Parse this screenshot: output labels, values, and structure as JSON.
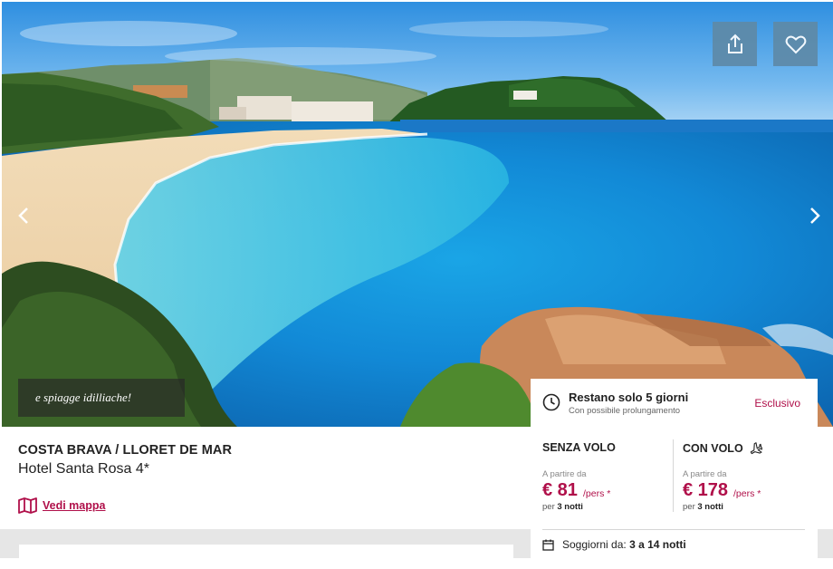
{
  "hero": {
    "caption": "e spiagge idilliache!",
    "share_icon": "share-icon",
    "favorite_icon": "heart-icon",
    "prev_icon": "chevron-left-icon",
    "next_icon": "chevron-right-icon"
  },
  "listing": {
    "destination": "COSTA BRAVA / LLORET DE MAR",
    "hotel_name": "Hotel Santa Rosa 4*",
    "map_link": "Vedi mappa",
    "map_icon": "map-icon"
  },
  "offer": {
    "availability": "Restano solo 5 giorni",
    "extension_note": "Con possibile prolungamento",
    "exclusive_badge": "Esclusivo",
    "without_flight": {
      "label": "SENZA VOLO",
      "from_text": "A partire da",
      "price": "€ 81",
      "unit": "/pers *",
      "per_prefix": "per",
      "nights": "3 notti"
    },
    "with_flight": {
      "label": "CON VOLO",
      "icon": "plane-icon",
      "from_text": "A partire da",
      "price": "€ 178",
      "unit": "/pers *",
      "per_prefix": "per",
      "nights": "3 notti"
    },
    "stay_label": "Soggiorni da:",
    "stay_range": "3 a 14 notti"
  },
  "colors": {
    "accent": "#b0104a",
    "icon_button_bg": "#5e8aa8"
  }
}
